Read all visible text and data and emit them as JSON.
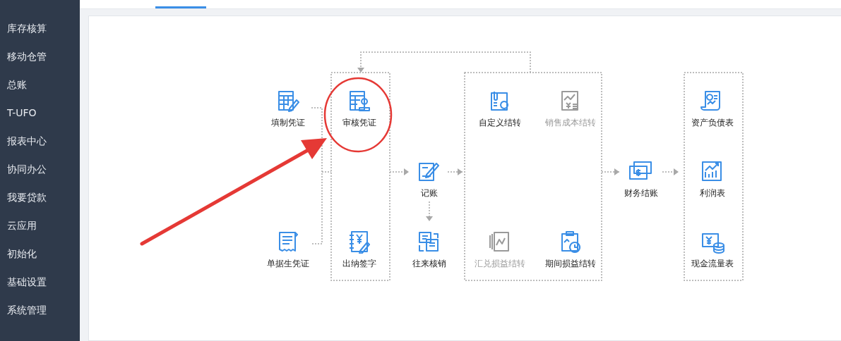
{
  "sidebar": {
    "items": [
      {
        "label": "库存核算"
      },
      {
        "label": "移动仓管"
      },
      {
        "label": "总账"
      },
      {
        "label": "T-UFO"
      },
      {
        "label": "报表中心"
      },
      {
        "label": "协同办公"
      },
      {
        "label": "我要贷款"
      },
      {
        "label": "云应用"
      },
      {
        "label": "初始化"
      },
      {
        "label": "基础设置"
      },
      {
        "label": "系统管理"
      }
    ]
  },
  "flow": {
    "nodes": [
      {
        "label": "填制凭证",
        "disabled": false
      },
      {
        "label": "单据生凭证",
        "disabled": false
      },
      {
        "label": "审核凭证",
        "disabled": false
      },
      {
        "label": "出纳签字",
        "disabled": false
      },
      {
        "label": "记账",
        "disabled": false
      },
      {
        "label": "往来核销",
        "disabled": false
      },
      {
        "label": "自定义结转",
        "disabled": false
      },
      {
        "label": "销售成本结转",
        "disabled": true
      },
      {
        "label": "汇兑损益结转",
        "disabled": true
      },
      {
        "label": "期间损益结转",
        "disabled": false
      },
      {
        "label": "财务结账",
        "disabled": false
      },
      {
        "label": "资产负债表",
        "disabled": false
      },
      {
        "label": "利润表",
        "disabled": false
      },
      {
        "label": "现金流量表",
        "disabled": false
      }
    ]
  }
}
